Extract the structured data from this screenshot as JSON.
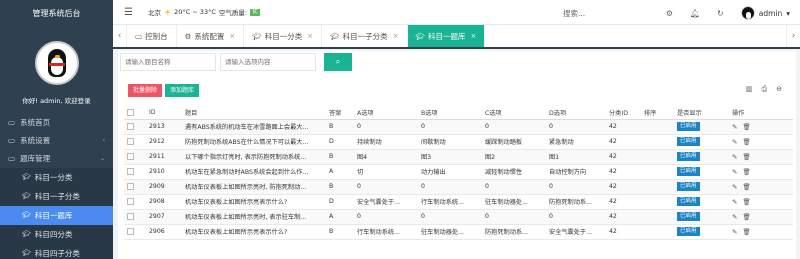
{
  "sidebar": {
    "brand": "管理系统后台",
    "welcome": "你好!  admin, 欢迎登录",
    "items": [
      {
        "label": "系统首页"
      },
      {
        "label": "系统设置"
      },
      {
        "label": "题库管理"
      }
    ],
    "sub_items": [
      {
        "label": "科目一分类"
      },
      {
        "label": "科目一子分类"
      },
      {
        "label": "科目一题库"
      },
      {
        "label": "科目四分类"
      },
      {
        "label": "科目四子分类"
      }
    ]
  },
  "topbar": {
    "city": "北京",
    "temp": "20°C ~ 33°C",
    "aq_label": "空气质量:",
    "aq_value": "优",
    "search": "搜索...",
    "username": "admin"
  },
  "tabs": [
    {
      "label": "控制台"
    },
    {
      "label": "系统配置"
    },
    {
      "label": "科目一分类"
    },
    {
      "label": "科目一子分类"
    },
    {
      "label": "科目一题库"
    }
  ],
  "search": {
    "name_placeholder": "请输入题目名称",
    "content_placeholder": "请输入选项内容"
  },
  "actions": {
    "batch_delete": "批量删除",
    "add": "添加题库"
  },
  "table": {
    "headers": [
      "ID",
      "题目",
      "答案",
      "A选项",
      "B选项",
      "C选项",
      "D选项",
      "分类ID",
      "排序",
      "是否显示",
      "操作"
    ],
    "rows": [
      {
        "id": "2913",
        "title": "遇有ABS系统的机动车在冰雪路面上会最大...",
        "answer": "B",
        "a": "0",
        "b": "0",
        "c": "0",
        "d": "0",
        "cat": "42",
        "sort": "",
        "status": "已启用"
      },
      {
        "id": "2912",
        "title": "防抱死制动系统ABS在什么情况下可以最大...",
        "answer": "D",
        "a": "持续制动",
        "b": "间歇制动",
        "c": "缓踩制动踏板",
        "d": "紧急制动",
        "cat": "42",
        "sort": "",
        "status": "已启用"
      },
      {
        "id": "2911",
        "title": "以下哪个指示灯亮时, 表示防抱死制动系统...",
        "answer": "B",
        "a": "图4",
        "b": "图3",
        "c": "图2",
        "d": "图1",
        "cat": "42",
        "sort": "",
        "status": "已启用"
      },
      {
        "id": "2910",
        "title": "机动车在紧急制动时ABS系统会起到什么作...",
        "answer": "A",
        "a": "切",
        "b": "动力输出",
        "c": "减轻制动惯性",
        "d": "自动控制方向",
        "cat": "42",
        "sort": "",
        "status": "已启用"
      },
      {
        "id": "2909",
        "title": "机动车仪表板上如图所示亮时, 防抱死制动...",
        "answer": "B",
        "a": "0",
        "b": "0",
        "c": "0",
        "d": "0",
        "cat": "42",
        "sort": "",
        "status": "已启用"
      },
      {
        "id": "2908",
        "title": "机动车仪表板上如图所示亮表示什么?",
        "answer": "D",
        "a": "安全气囊处于...",
        "b": "行车制动系统...",
        "c": "驻车制动器处...",
        "d": "防抱死制动系...",
        "cat": "42",
        "sort": "",
        "status": "已启用"
      },
      {
        "id": "2907",
        "title": "机动车仪表板上如图所示亮时, 表示驻车制...",
        "answer": "A",
        "a": "0",
        "b": "0",
        "c": "0",
        "d": "0",
        "cat": "42",
        "sort": "",
        "status": "已启用"
      },
      {
        "id": "2906",
        "title": "机动车仪表板上如图所示亮表示什么?",
        "answer": "B",
        "a": "行车制动系统...",
        "b": "驻车制动器处...",
        "c": "防抱死制动系...",
        "d": "安全气囊处于...",
        "cat": "42",
        "sort": "",
        "status": "已启用"
      }
    ]
  }
}
